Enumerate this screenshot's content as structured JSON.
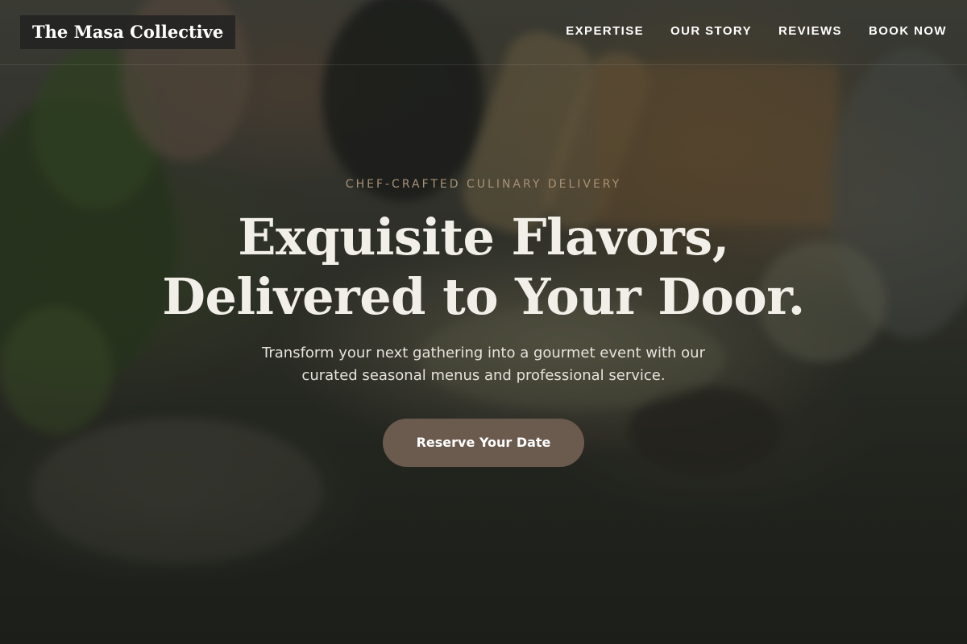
{
  "header": {
    "logo": "The Masa Collective",
    "nav": [
      {
        "label": "EXPERTISE"
      },
      {
        "label": "OUR STORY"
      },
      {
        "label": "REVIEWS"
      },
      {
        "label": "BOOK NOW"
      }
    ]
  },
  "hero": {
    "eyebrow": "CHEF-CRAFTED CULINARY DELIVERY",
    "headline_line1": "Exquisite Flavors,",
    "headline_line2": "Delivered to Your Door.",
    "subtext_line1": "Transform your next gathering into a gourmet event with our",
    "subtext_line2": "curated seasonal menus and professional service.",
    "cta_label": "Reserve Your Date"
  },
  "colors": {
    "accent": "#6b5a4e",
    "eyebrow": "#a89276",
    "heading": "#f2efe9",
    "logo_bg": "#222222"
  }
}
